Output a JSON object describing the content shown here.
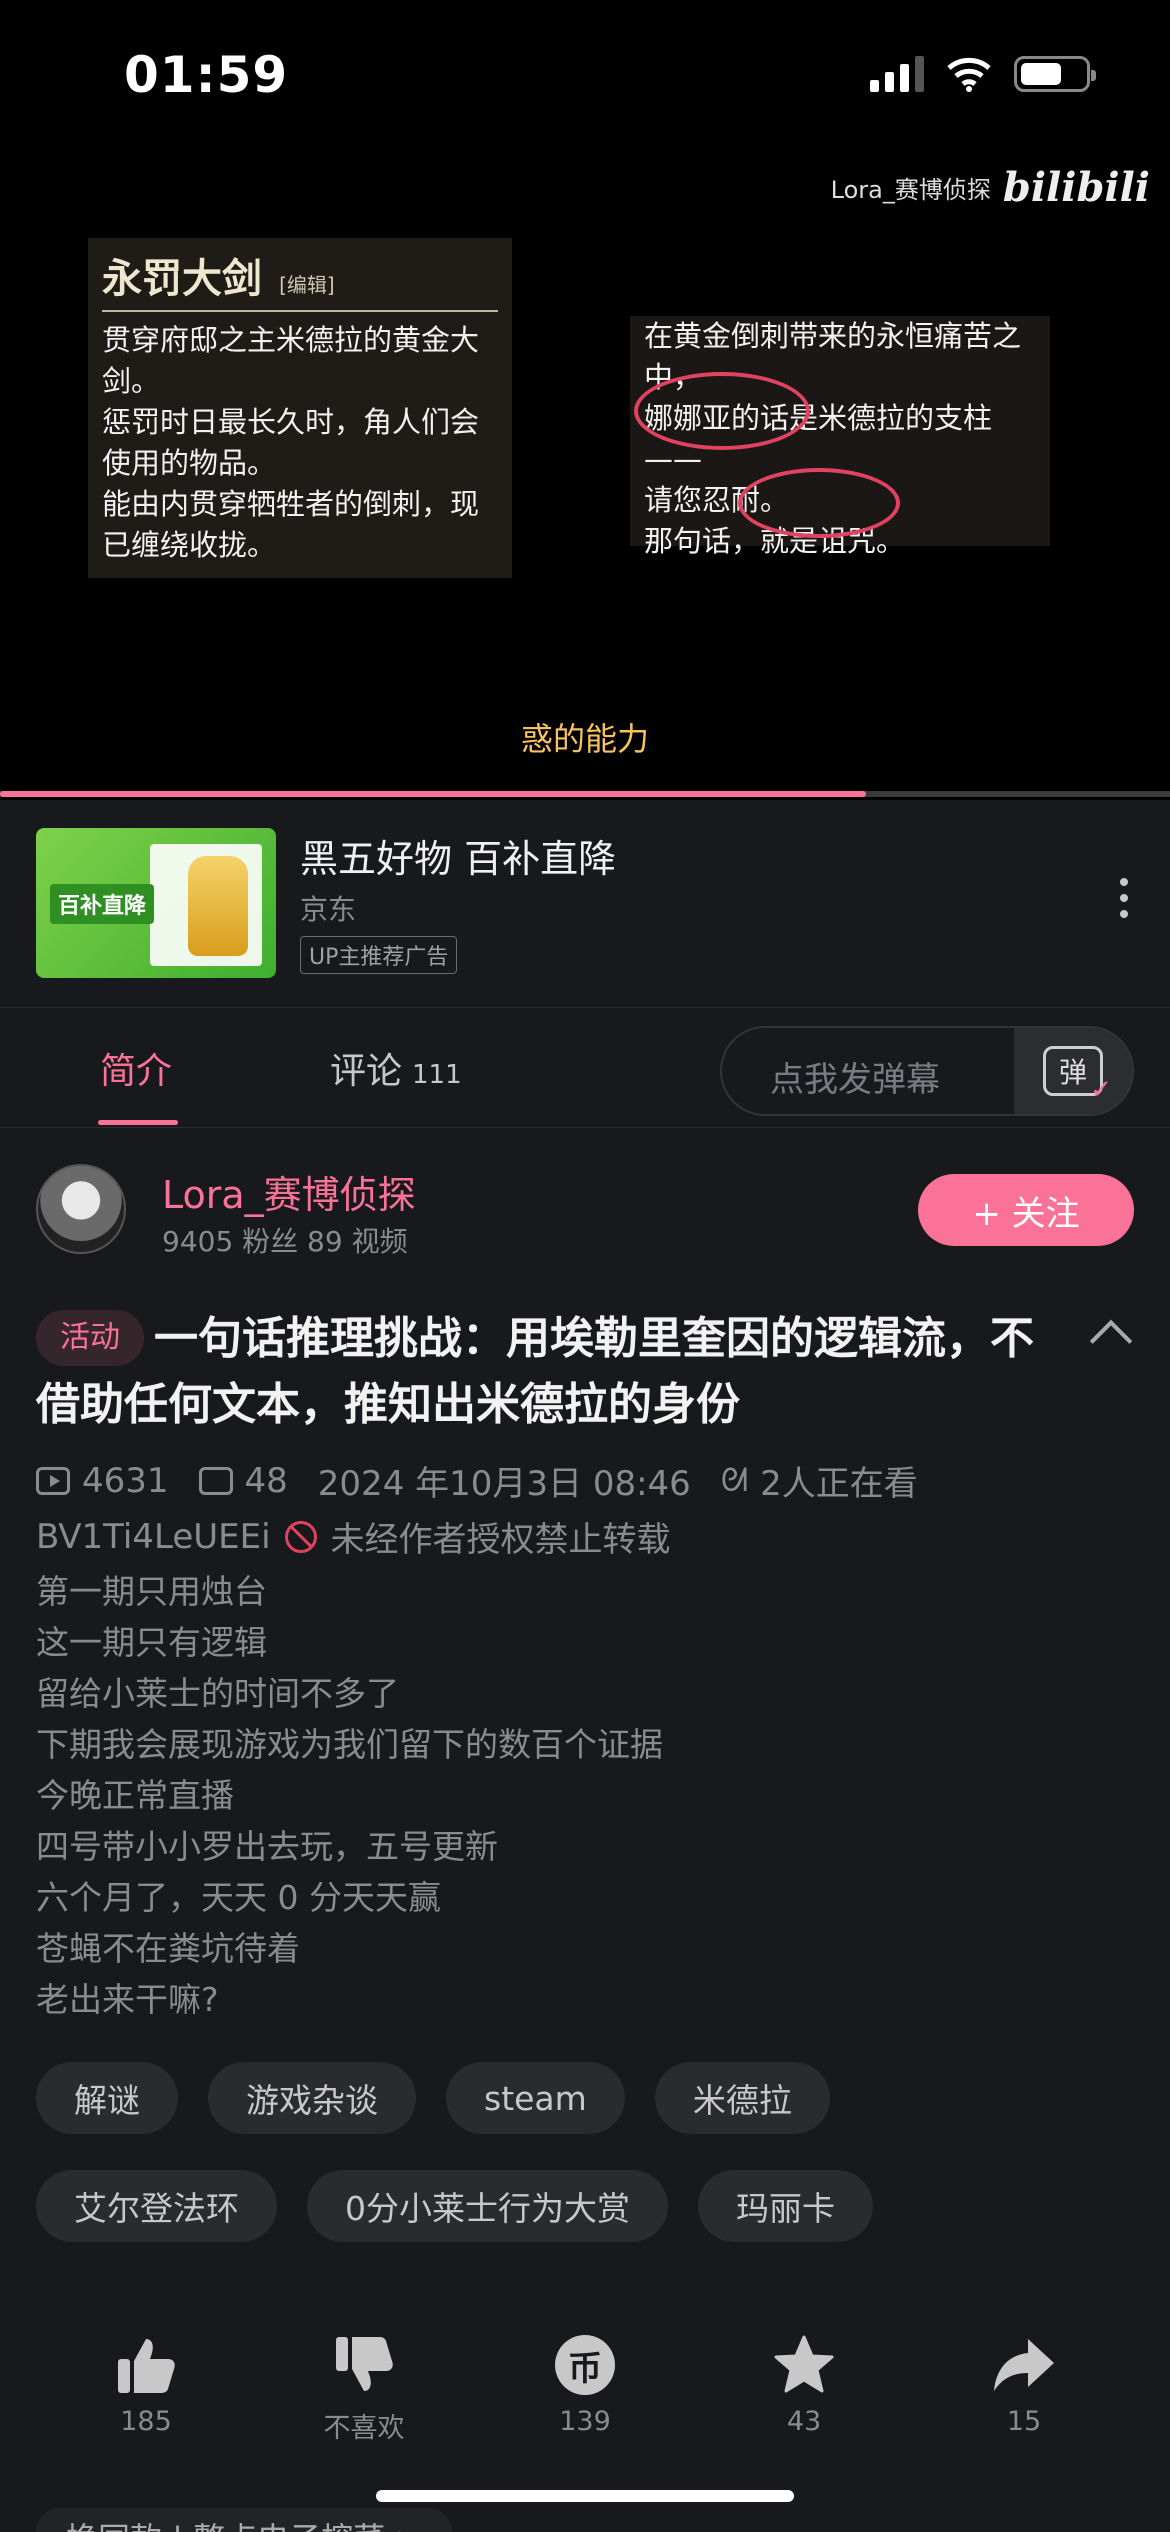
{
  "status_bar": {
    "time": "01:59"
  },
  "video": {
    "watermark_user": "Lora_赛博侦探",
    "watermark_logo": "bilibili",
    "left_card": {
      "title": "永罚大剑",
      "edit": "[编辑]",
      "body": "贯穿府邸之主米德拉的黄金大\n剑。\n惩罚时日最长久时，角人们会\n使用的物品。\n能由内贯穿牺牲者的倒刺，现\n已缠绕收拢。"
    },
    "right_card": {
      "body": "在黄金倒刺带来的永恒痛苦之\n中，\n娜娜亚的话是米德拉的支柱——\n  请您忍耐。\n那句话，就是诅咒。"
    },
    "subtitle": "惑的能力",
    "progress": 0.74
  },
  "ad": {
    "thumb_label": "百补直降",
    "title": "黑五好物 百补直降",
    "brand": "京东",
    "tag": "UP主推荐广告"
  },
  "tabs": {
    "intro": "简介",
    "comments": "评论",
    "comments_count": "111",
    "danmaku_placeholder": "点我发弹幕",
    "danmaku_btn": "弹"
  },
  "uploader": {
    "name": "Lora_赛博侦探",
    "stats": "9405 粉丝   89 视频",
    "follow_label": "+ 关注"
  },
  "video_info": {
    "activity_badge": "活动",
    "title": "一句话推理挑战：用埃勒里奎因的逻辑流，不借助任何文本，推知出米德拉的身份",
    "views": "4631",
    "danmaku_count": "48",
    "date": "2024 年10月3日  08:46",
    "watching": "2人正在看",
    "bvid": "BV1Ti4LeUEEi",
    "copyright": "未经作者授权禁止转载",
    "description": [
      "第一期只用烛台",
      "这一期只有逻辑",
      "留给小莱士的时间不多了",
      "下期我会展现游戏为我们留下的数百个证据",
      "今晚正常直播",
      "四号带小小罗出去玩，五号更新",
      "六个月了，天天 0 分天天赢",
      "苍蝇不在粪坑待着",
      "老出来干嘛?"
    ]
  },
  "tags": {
    "row1": [
      "解谜",
      "游戏杂谈",
      "steam",
      "米德拉"
    ],
    "row2": [
      "艾尔登法环",
      "0分小莱士行为大赏",
      "玛丽卡"
    ]
  },
  "actions": {
    "like": "185",
    "dislike": "不喜欢",
    "coin": "139",
    "coin_glyph": "币",
    "favorite": "43",
    "share": "15"
  },
  "bottom_peek": "换同款 | 整点电子榨菜 >"
}
